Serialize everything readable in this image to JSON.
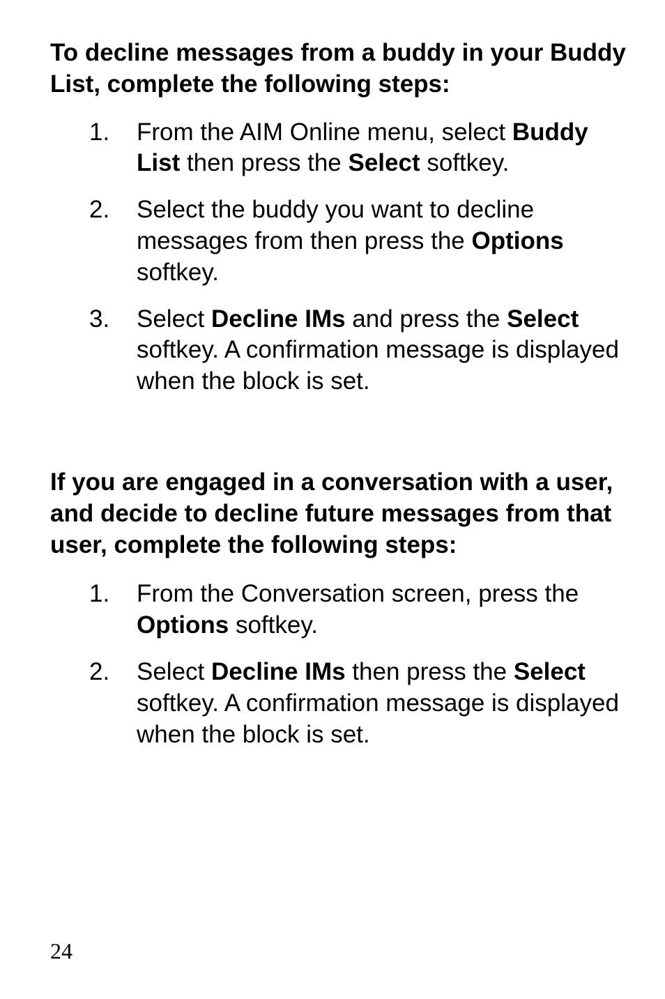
{
  "heading1": "To decline messages from a buddy in your Buddy List, complete the following steps:",
  "steps1": [
    {
      "num": "1.",
      "parts": [
        "From the AIM Online menu, select ",
        "Buddy List",
        " then press the ",
        "Select",
        " softkey."
      ]
    },
    {
      "num": "2.",
      "parts": [
        "Select the buddy you want to decline messages from then press the ",
        "Options",
        " softkey."
      ]
    },
    {
      "num": "3.",
      "parts": [
        "Select ",
        "Decline IMs",
        " and press the ",
        "Select",
        " softkey. A confirmation message is displayed when the block is set."
      ]
    }
  ],
  "heading2": "If you are engaged in a conversation with a user, and decide to decline future messages from that user, complete the following steps:",
  "steps2": [
    {
      "num": "1.",
      "parts": [
        "From the Conversation screen, press the ",
        "Options",
        " softkey."
      ]
    },
    {
      "num": "2.",
      "parts": [
        "Select ",
        "Decline IMs",
        " then press the ",
        "Select",
        " softkey. A confirmation message is displayed when the block is set."
      ]
    }
  ],
  "pageNumber": "24"
}
